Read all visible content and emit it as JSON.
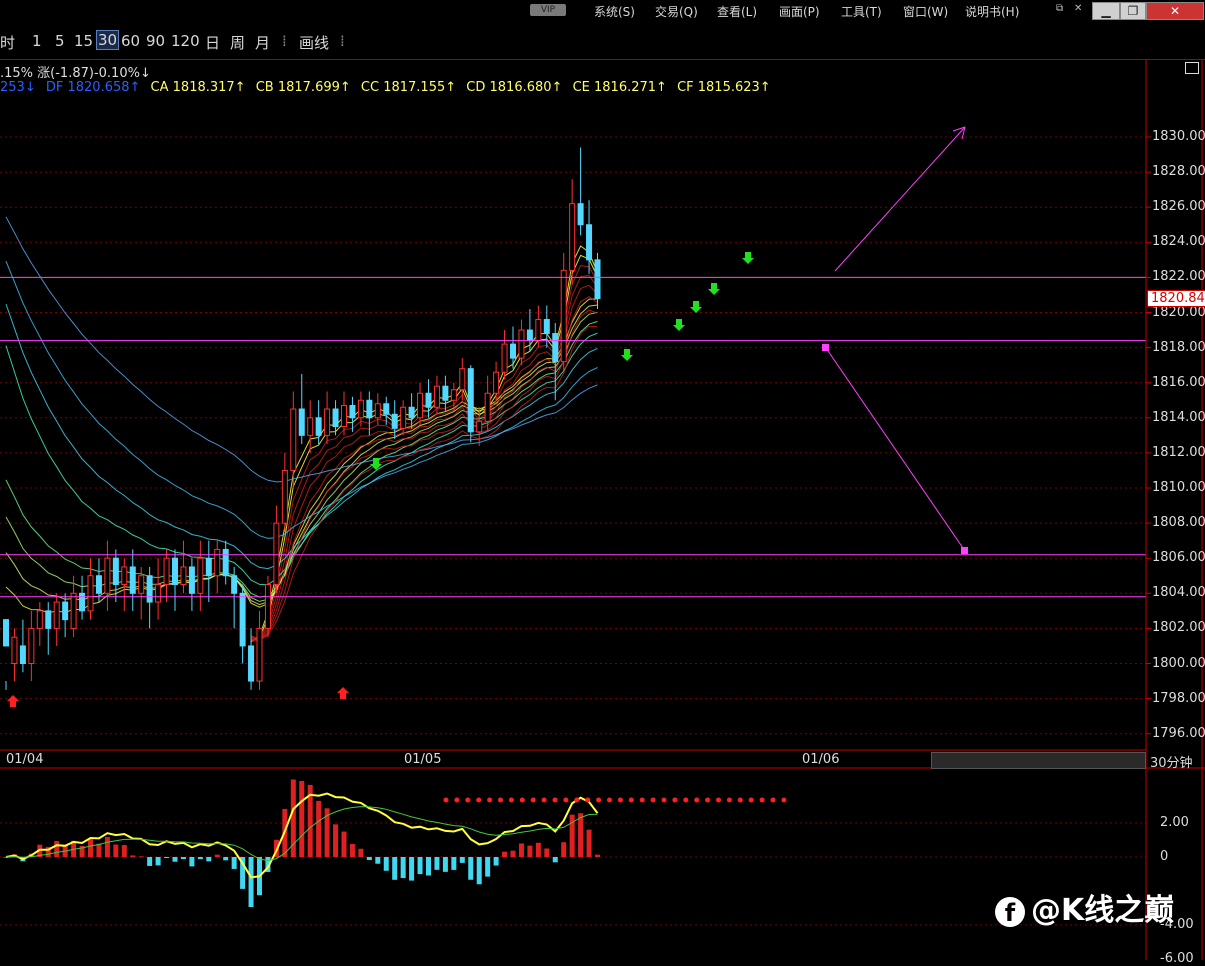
{
  "menubar": {
    "vip": "VIP",
    "items": [
      "系统(S)",
      "交易(Q)",
      "查看(L)",
      "画面(P)",
      "工具(T)",
      "窗口(W)",
      "说明书(H)"
    ]
  },
  "toolbar": {
    "periods": [
      "时",
      "1",
      "5",
      "15",
      "30",
      "60",
      "90",
      "120",
      "日",
      "周",
      "月"
    ],
    "active": "30",
    "draw_label": "画线"
  },
  "info_line1": {
    "prefix": ".15%",
    "change": "涨(-1.87)-0.10%↓"
  },
  "info_line2": [
    {
      "text": "253↓",
      "color": "#2a5fff"
    },
    {
      "text": "DF 1820.658↑",
      "color": "#2a5fff"
    },
    {
      "text": "CA 1818.317↑",
      "color": "#ffff66"
    },
    {
      "text": "CB 1817.699↑",
      "color": "#ffff66"
    },
    {
      "text": "CC 1817.155↑",
      "color": "#ffff66"
    },
    {
      "text": "CD 1816.680↑",
      "color": "#ffff66"
    },
    {
      "text": "CE 1816.271↑",
      "color": "#ffff66"
    },
    {
      "text": "CF 1815.623↑",
      "color": "#ffff66"
    }
  ],
  "price_axis": [
    "1830.00",
    "1828.00",
    "1826.00",
    "1824.00",
    "1822.00",
    "1820.00",
    "1818.00",
    "1816.00",
    "1814.00",
    "1812.00",
    "1810.00",
    "1808.00",
    "1806.00",
    "1804.00",
    "1802.00",
    "1800.00",
    "1798.00",
    "1796.00"
  ],
  "current_price": "1820.84",
  "dates": [
    "01/04",
    "01/05",
    "01/06"
  ],
  "period_label": "30分钟",
  "macd_axis": [
    "2.00",
    "0",
    "-4.00",
    "-6.00"
  ],
  "watermark": "@K线之巅",
  "chart_data": {
    "type": "candlestick",
    "timeframe": "30分钟",
    "ylim": [
      1796,
      1830
    ],
    "horizontal_levels": [
      1822.0,
      1818.4,
      1806.2,
      1803.8
    ],
    "last_price": 1820.84,
    "colors": {
      "up": "#ff3030",
      "down": "#54d8ff",
      "level": "#ff40ff"
    },
    "ohlc_shape": [
      [
        1802.5,
        1801,
        1799,
        1798.5
      ],
      [
        1800,
        1801.5,
        1802,
        1799
      ],
      [
        1801,
        1800,
        1802.5,
        1799.5
      ],
      [
        1800,
        1802,
        1803,
        1799
      ],
      [
        1802,
        1803,
        1803.5,
        1801
      ],
      [
        1803,
        1802,
        1803.5,
        1800.5
      ],
      [
        1802,
        1803.5,
        1804,
        1801
      ],
      [
        1803.5,
        1802.5,
        1804,
        1801.5
      ],
      [
        1802,
        1804,
        1805,
        1801.5
      ],
      [
        1804,
        1803,
        1805,
        1802.5
      ],
      [
        1803,
        1805,
        1806,
        1802.5
      ],
      [
        1805,
        1804,
        1806,
        1803.5
      ],
      [
        1804,
        1806,
        1807,
        1803
      ],
      [
        1806,
        1804.5,
        1806.5,
        1803.5
      ],
      [
        1804.5,
        1805.5,
        1806,
        1803
      ],
      [
        1805.5,
        1804,
        1806.5,
        1803
      ],
      [
        1804,
        1805,
        1805.5,
        1802.5
      ],
      [
        1805,
        1803.5,
        1805.5,
        1802
      ],
      [
        1803.5,
        1804.5,
        1806,
        1802.5
      ],
      [
        1804.5,
        1806,
        1806.5,
        1803.5
      ],
      [
        1806,
        1804.5,
        1806.5,
        1803
      ],
      [
        1804.5,
        1805.5,
        1807,
        1804
      ],
      [
        1805.5,
        1804,
        1806,
        1803
      ],
      [
        1804,
        1806,
        1807,
        1803
      ],
      [
        1806,
        1805,
        1807,
        1803.5
      ],
      [
        1805,
        1806.5,
        1807,
        1804
      ],
      [
        1806.5,
        1805,
        1807,
        1804.5
      ],
      [
        1805,
        1804,
        1805.5,
        1802
      ],
      [
        1804,
        1801,
        1804.5,
        1800
      ],
      [
        1801,
        1799,
        1802,
        1798.5
      ],
      [
        1799,
        1802,
        1803,
        1798.5
      ],
      [
        1802,
        1804.5,
        1805,
        1801.5
      ],
      [
        1804.5,
        1808,
        1809,
        1804
      ],
      [
        1808,
        1811,
        1812,
        1807.5
      ],
      [
        1811,
        1814.5,
        1815.5,
        1810
      ],
      [
        1814.5,
        1813,
        1816.5,
        1812.5
      ],
      [
        1813,
        1814,
        1815,
        1812
      ],
      [
        1814,
        1813,
        1815,
        1812.5
      ],
      [
        1813,
        1814.5,
        1815.5,
        1812.5
      ],
      [
        1814.5,
        1813.5,
        1815,
        1813
      ],
      [
        1813.5,
        1814.7,
        1815.5,
        1813
      ],
      [
        1814.7,
        1814,
        1815.2,
        1813.2
      ],
      [
        1814,
        1815,
        1815.5,
        1813.5
      ],
      [
        1815,
        1814,
        1815.5,
        1813
      ],
      [
        1814,
        1814.8,
        1815.4,
        1813.6
      ],
      [
        1814.8,
        1814.2,
        1815.2,
        1813.6
      ],
      [
        1814.2,
        1813.4,
        1815,
        1812.8
      ],
      [
        1813.4,
        1814.6,
        1815,
        1813
      ],
      [
        1814.6,
        1814,
        1815.4,
        1813.4
      ],
      [
        1814,
        1815.4,
        1816,
        1813.6
      ],
      [
        1815.4,
        1814.6,
        1816.2,
        1814
      ],
      [
        1814.6,
        1815.8,
        1816.4,
        1814.2
      ],
      [
        1815.8,
        1815,
        1816.4,
        1814.4
      ],
      [
        1815,
        1815.6,
        1816,
        1814.4
      ],
      [
        1815.6,
        1816.8,
        1817.4,
        1815
      ],
      [
        1816.8,
        1813.2,
        1817,
        1812.6
      ],
      [
        1813.2,
        1813.8,
        1814.6,
        1812.4
      ],
      [
        1813.8,
        1815.4,
        1816.4,
        1813.2
      ],
      [
        1815.4,
        1816.6,
        1817.2,
        1815
      ],
      [
        1816.6,
        1818.2,
        1819,
        1816.2
      ],
      [
        1818.2,
        1817.4,
        1819.2,
        1816.8
      ],
      [
        1817.4,
        1819,
        1819.6,
        1817
      ],
      [
        1819,
        1818.4,
        1820.2,
        1817.8
      ],
      [
        1818.4,
        1819.6,
        1820.4,
        1818
      ],
      [
        1819.6,
        1818.8,
        1820.4,
        1818
      ],
      [
        1818.8,
        1817.2,
        1819.4,
        1815
      ],
      [
        1817.2,
        1822.4,
        1823.4,
        1816.6
      ],
      [
        1822.4,
        1826.2,
        1827.6,
        1821.6
      ],
      [
        1826.2,
        1825,
        1829.4,
        1824.4
      ],
      [
        1825,
        1823,
        1826.4,
        1822.2
      ],
      [
        1823,
        1820.8,
        1823.4,
        1820.2
      ]
    ],
    "macd_ylim": [
      -6,
      4
    ]
  }
}
